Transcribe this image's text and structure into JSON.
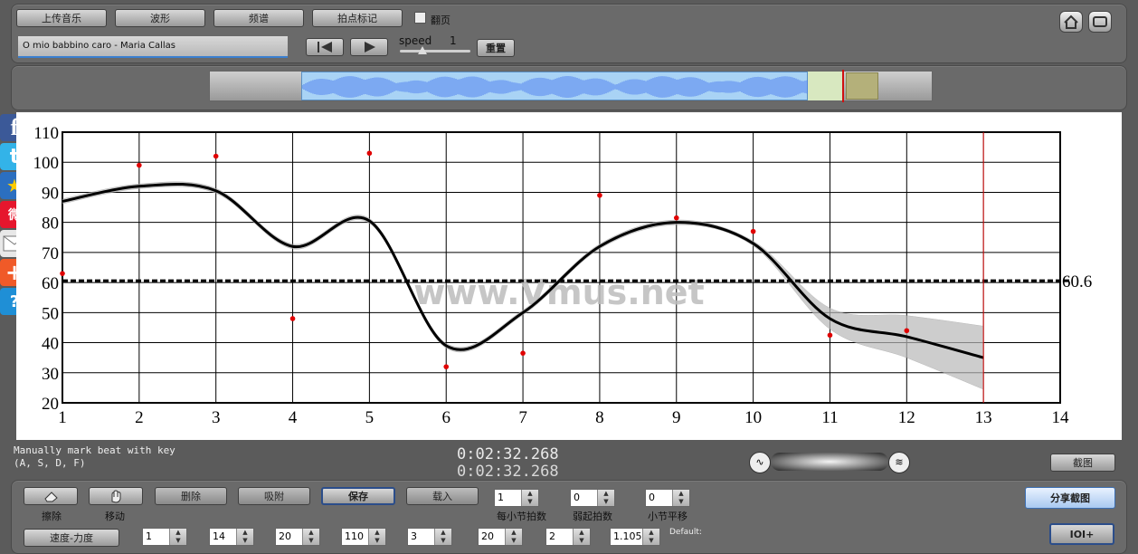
{
  "toolbar": {
    "upload": "上传音乐",
    "waveform": "波形",
    "spectrum": "频谱",
    "beat_mark": "拍点标记",
    "page_flip": "翻页",
    "page_flip_checked": false
  },
  "track": {
    "title": "O mio babbino caro - Maria Callas"
  },
  "player": {
    "speed_label": "speed",
    "speed_value": "1",
    "reset": "重置"
  },
  "chart_data": {
    "type": "line",
    "x": [
      1,
      2,
      3,
      4,
      5,
      6,
      7,
      8,
      9,
      10,
      11,
      12,
      13
    ],
    "series": [
      {
        "values": [
          63,
          99,
          102,
          48,
          103,
          32,
          36.5,
          89,
          81.5,
          77,
          42.5,
          44,
          null
        ]
      },
      {
        "values": [
          87,
          92,
          90.5,
          72,
          80.5,
          39,
          50,
          72,
          80,
          73,
          48,
          42,
          35
        ]
      }
    ],
    "mean_value": 60.6,
    "mean_label": "60.6",
    "xlim": [
      1,
      14
    ],
    "ylim": [
      20,
      110
    ],
    "x_ticks": [
      "1",
      "2",
      "3",
      "4",
      "5",
      "6",
      "7",
      "8",
      "9",
      "10",
      "11",
      "12",
      "13",
      "14"
    ],
    "y_ticks": [
      "20",
      "30",
      "40",
      "50",
      "60",
      "70",
      "80",
      "90",
      "100",
      "110"
    ],
    "cursor_x": 13,
    "grid": true,
    "watermark": "www.Vmus.net"
  },
  "status": {
    "hint_line1": "Manually mark beat with key",
    "hint_line2": "(A, S, D, F)",
    "time1": "0:02:32.268",
    "time2": "0:02:32.268",
    "screenshot": "截图"
  },
  "bottom": {
    "erase": "擦除",
    "move": "移动",
    "delete": "删除",
    "snap": "吸附",
    "save": "保存",
    "load": "载入",
    "beats_per_bar": "1",
    "beats_per_bar_label": "每小节拍数",
    "weak_beat": "0",
    "weak_beat_label": "弱起拍数",
    "bar_shift": "0",
    "bar_shift_label": "小节平移",
    "share": "分享截图",
    "ioi": "IOI+",
    "speed_force": "速度-力度",
    "params": [
      "1",
      "14",
      "20",
      "110",
      "3",
      "20",
      "2",
      "1.105"
    ],
    "default_label": "Default:"
  }
}
